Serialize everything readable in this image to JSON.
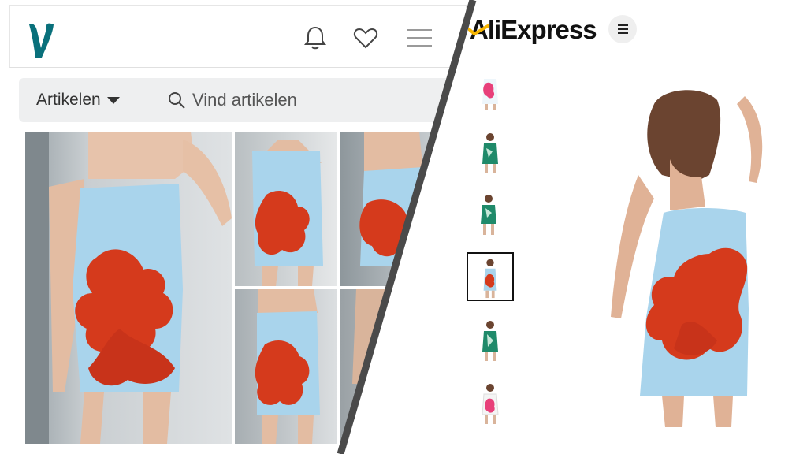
{
  "vinted": {
    "logo_icon": "vinted-v-logo",
    "header_icons": [
      "bell-icon",
      "heart-icon",
      "hamburger-menu-icon"
    ],
    "search": {
      "category_label": "Artikelen",
      "placeholder": "Vind artikelen"
    },
    "colors": {
      "brand": "#09707b",
      "search_bg": "#eeeff0"
    }
  },
  "aliexpress": {
    "logo_text": "AliExpress",
    "menu_icon": "hamburger-menu-icon",
    "thumbnails": [
      {
        "dress": "light-blue-floral",
        "selected": false
      },
      {
        "dress": "green-print",
        "selected": false
      },
      {
        "dress": "green-print",
        "selected": false
      },
      {
        "dress": "light-blue-floral",
        "selected": true
      },
      {
        "dress": "green-print",
        "selected": false
      },
      {
        "dress": "white-floral",
        "selected": false
      }
    ],
    "colors": {
      "swoosh": "#f7b500"
    }
  },
  "dress_colors": {
    "fabric": "#a9d4ec",
    "flower": "#d53a1c",
    "green": "#1f8a6a"
  }
}
